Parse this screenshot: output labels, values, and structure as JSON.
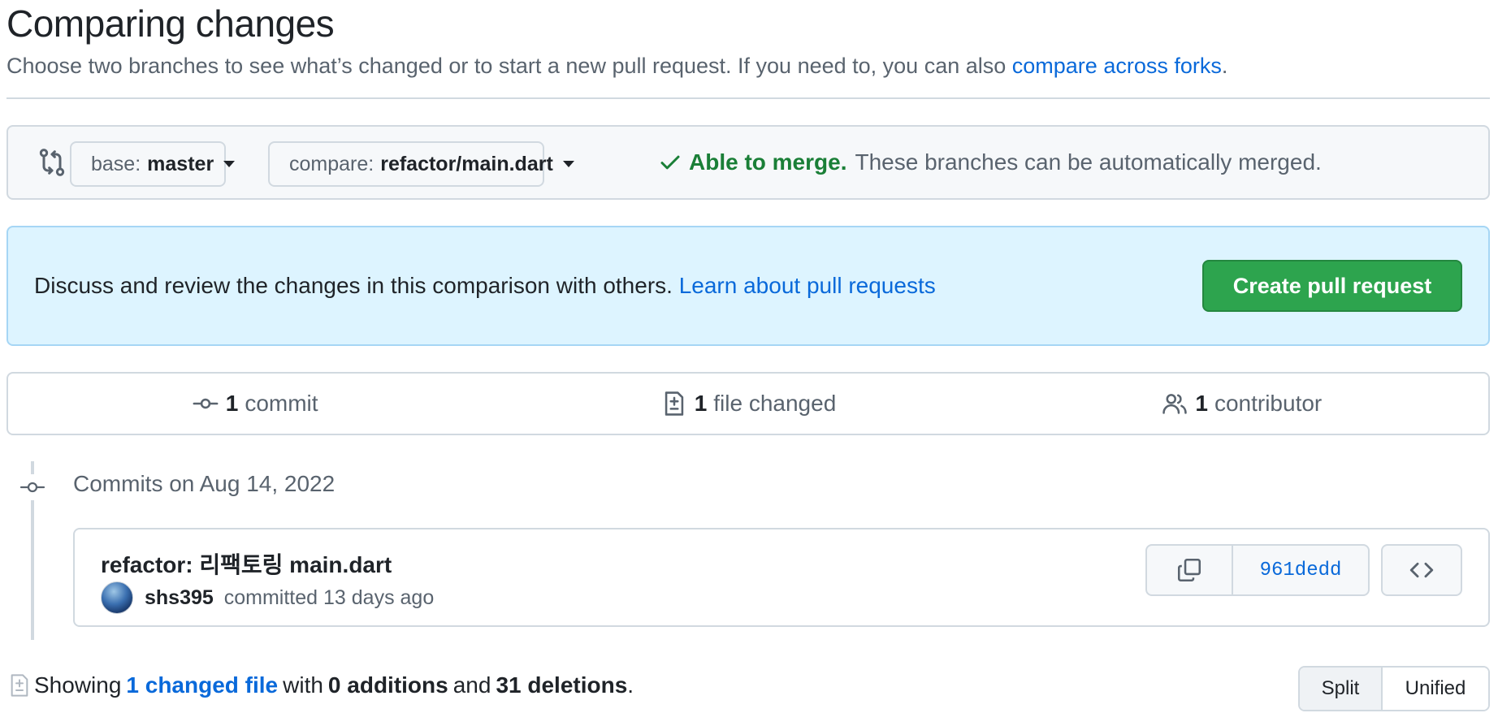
{
  "header": {
    "title": "Comparing changes",
    "subtitle": "Choose two branches to see what’s changed or to start a new pull request. If you need to, you can also ",
    "subtitle_link": "compare across forks",
    "subtitle_end": "."
  },
  "range": {
    "base_prefix": "base:",
    "base_branch": "master",
    "compare_prefix": "compare:",
    "compare_branch": "refactor/main.dart",
    "merge_ok": "Able to merge.",
    "merge_text": "These branches can be automatically merged."
  },
  "discuss": {
    "text": "Discuss and review the changes in this comparison with others. ",
    "link": "Learn about pull requests",
    "button": "Create pull request"
  },
  "summary": {
    "commits_count": "1",
    "commits_label": "commit",
    "files_count": "1",
    "files_label": "file changed",
    "contributors_count": "1",
    "contributors_label": "contributor"
  },
  "timeline": {
    "date_header": "Commits on Aug 14, 2022",
    "commit": {
      "message": "refactor: 리팩토링 main.dart",
      "author": "shs395",
      "meta": "committed 13 days ago",
      "sha": "961dedd"
    }
  },
  "diffstat": {
    "showing": "Showing",
    "files_link": "1 changed file",
    "with": "with",
    "additions": "0 additions",
    "and": "and",
    "deletions": "31 deletions",
    "end": "."
  },
  "view_toggle": {
    "split": "Split",
    "unified": "Unified"
  },
  "colors": {
    "accent_link": "#0969da",
    "success_green": "#1a7f37",
    "button_green": "#2da44e",
    "info_bg": "#ddf4ff"
  }
}
